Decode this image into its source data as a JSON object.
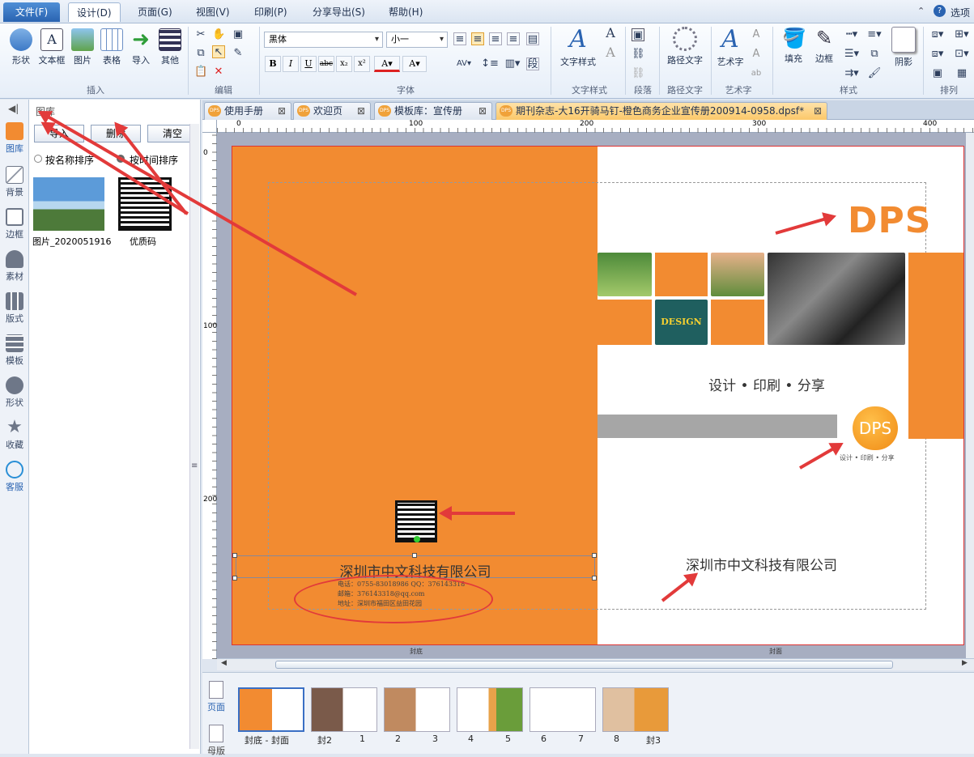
{
  "menubar": {
    "file": "文件(F)",
    "items": [
      "设计(D)",
      "页面(G)",
      "视图(V)",
      "印刷(P)",
      "分享导出(S)",
      "帮助(H)"
    ],
    "right_label": "选项"
  },
  "ribbon": {
    "insert": {
      "buttons": [
        "形状",
        "文本框",
        "图片",
        "表格",
        "导入",
        "其他"
      ],
      "label": "插入"
    },
    "edit": {
      "label": "编辑"
    },
    "font": {
      "family": "黑体",
      "size": "小一",
      "label": "字体"
    },
    "text_style": {
      "button": "文字样式",
      "label": "文字样式"
    },
    "paragraph": {
      "label": "段落"
    },
    "path_text": {
      "button": "路径文字",
      "label": "路径文字"
    },
    "art_text": {
      "button": "艺术字",
      "label": "艺术字"
    },
    "style": {
      "buttons": [
        "填充",
        "边框",
        "阴影"
      ],
      "label": "样式"
    },
    "arrange": {
      "label": "排列"
    }
  },
  "left_strip": [
    "图库",
    "背景",
    "边框",
    "素材",
    "版式",
    "模板",
    "形状",
    "收藏",
    "客服"
  ],
  "gallery": {
    "title": "图库",
    "buttons": [
      "导入",
      "删除",
      "清空"
    ],
    "sort_name": "按名称排序",
    "sort_time": "按时间排序",
    "items": [
      "图片_2020051916",
      "优质码"
    ]
  },
  "doc_tabs": [
    "使用手册",
    "欢迎页",
    "模板库：宣传册",
    "期刊杂志-大16开骑马钉-橙色商务企业宣传册200914-0958.dpsf*"
  ],
  "ruler": {
    "h": [
      "0",
      "100",
      "200",
      "300",
      "400"
    ],
    "v": [
      "0",
      "100",
      "200"
    ]
  },
  "page": {
    "back_label": "封底",
    "front_label": "封面",
    "company": "深圳市中文科技有限公司",
    "contact_phone": "电话：0755-83018986  QQ：376143318",
    "contact_mail": "邮箱：376143318@qq.com",
    "contact_addr": "地址：深圳市福田区益田花园",
    "dps_big": "DPS",
    "slogan": "设计 • 印刷 • 分享",
    "dps_circle": "DPS",
    "dps_circle_sub": "设计 • 印刷 • 分享",
    "company_front": "深圳市中文科技有限公司",
    "design_word": "DESIGN"
  },
  "thumbs": {
    "side_tab_top": "页面",
    "side_tab_bottom": "母版",
    "labels": [
      "封底 - 封面",
      "封2",
      "1",
      "2",
      "3",
      "4",
      "5",
      "6",
      "7",
      "8",
      "封3"
    ]
  },
  "colors": {
    "orange": "#f28b31",
    "ribbon_blue": "#2a63b1",
    "arrow": "#e23a3a"
  }
}
